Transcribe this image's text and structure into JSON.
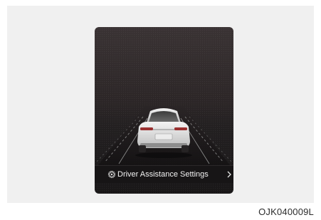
{
  "display": {
    "menu_label": "Driver Assistance Settings",
    "menu_icon": "gear-icon",
    "arrow_icon": "chevron-right-icon"
  },
  "figure_code": "OJK040009L",
  "colors": {
    "screen_background": "#2c2627",
    "outer_panel": "#f0f0f0",
    "car_body": "#d9d9d9",
    "menu_bar": "#171516",
    "lane_lines": "#9a9a9a"
  }
}
